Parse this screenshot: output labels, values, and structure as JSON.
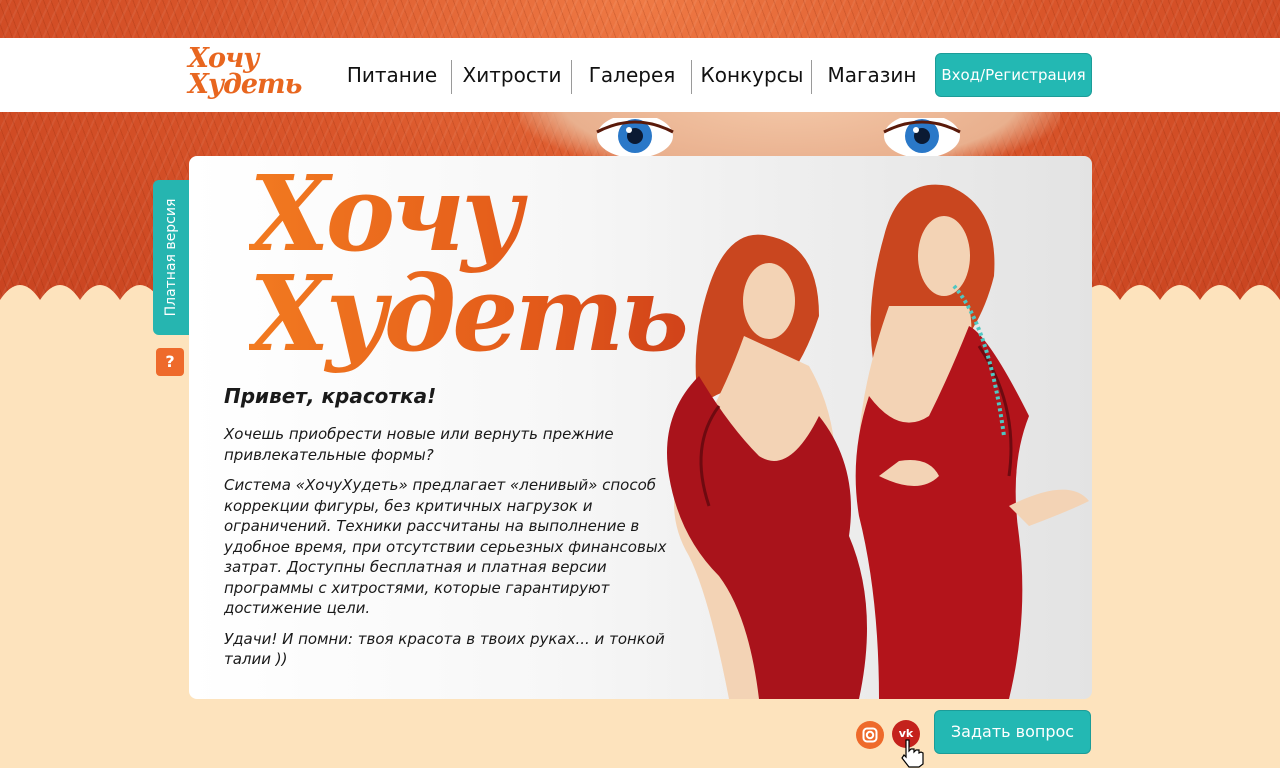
{
  "header": {
    "logo_line1": "Хочу",
    "logo_line2": "Худеть",
    "nav": [
      {
        "label": "Питание"
      },
      {
        "label": "Хитрости"
      },
      {
        "label": "Галерея"
      },
      {
        "label": "Конкурсы"
      },
      {
        "label": "Магазин"
      }
    ],
    "login_label": "Вход/Регистрация"
  },
  "sidebar": {
    "paid_version_label": "Платная версия",
    "help_label": "?"
  },
  "main": {
    "big_logo_line1": "Хочу",
    "big_logo_line2": "Худеть",
    "greeting": "Привет, красотка!",
    "paragraphs": [
      "Хочешь приобрести новые или вернуть прежние привлекательные формы?",
      "Система «ХочуХудеть» предлагает «ленивый» способ коррекции фигуры, без критичных нагрузок и ограничений. Техники рассчитаны на выполнение в удобное время, при отсутствии серьезных финансовых затрат. Доступны бесплатная и платная версии программы с хитростями, которые гарантируют достижение цели.",
      "Удачи! И помни: твоя красота в твоих руках... и тонкой талии ))"
    ]
  },
  "footer": {
    "ask_label": "Задать вопрос",
    "vk_label": "vk"
  },
  "colors": {
    "accent_teal": "#23b8b3",
    "brand_orange": "#e8661f",
    "hair": "#d9552a",
    "page_bg": "#fde3bd",
    "dress_red": "#b3141b"
  },
  "icons": [
    "instagram-icon",
    "vk-icon",
    "hand-cursor-icon",
    "question-icon"
  ]
}
